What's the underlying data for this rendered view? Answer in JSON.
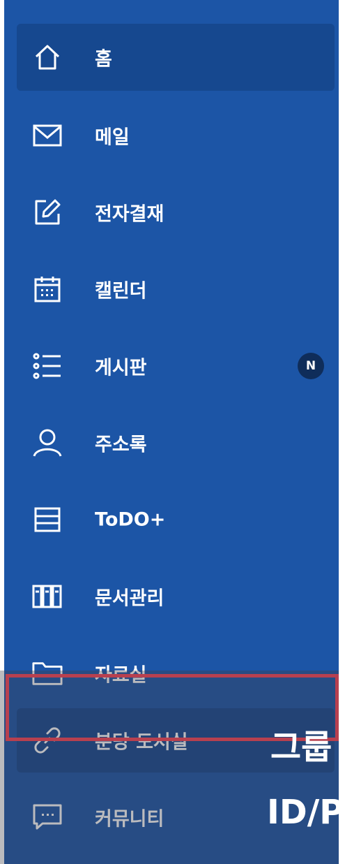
{
  "sidebar": {
    "items": [
      {
        "label": "홈",
        "icon": "home-icon",
        "active": true
      },
      {
        "label": "메일",
        "icon": "mail-icon"
      },
      {
        "label": "전자결재",
        "icon": "edit-icon"
      },
      {
        "label": "캘린더",
        "icon": "calendar-icon"
      },
      {
        "label": "게시판",
        "icon": "list-icon",
        "badge": "N"
      },
      {
        "label": "주소록",
        "icon": "person-icon"
      },
      {
        "label": "ToDO+",
        "icon": "lines-icon"
      },
      {
        "label": "문서관리",
        "icon": "binder-icon"
      },
      {
        "label": "자료실",
        "icon": "folder-icon"
      },
      {
        "label": "분당 도서실",
        "icon": "link-icon",
        "highlighted": true
      },
      {
        "label": "커뮤니티",
        "icon": "chat-icon"
      }
    ]
  },
  "overlay": {
    "line1": "그룹",
    "line2": "ID/P"
  },
  "colors": {
    "sidebar_bg": "#1c55a6",
    "active_bg": "#16488f",
    "badge_bg": "#0f2d5a",
    "highlight_border": "#b8404f"
  }
}
